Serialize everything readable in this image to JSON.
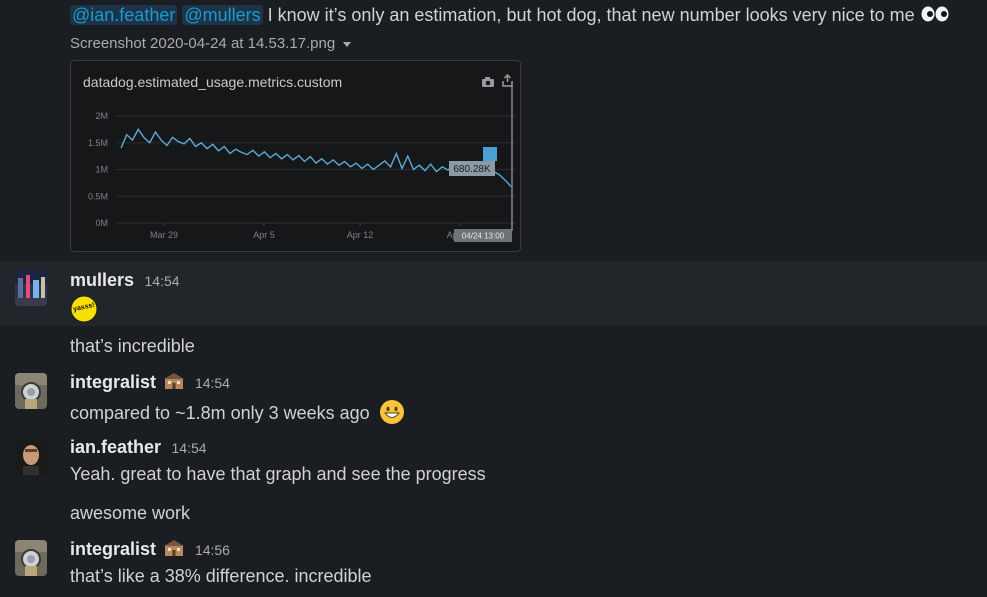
{
  "messages": [
    {
      "mentions": [
        "@ian.feather",
        "@mullers"
      ],
      "text": "I know it’s only an estimation, but hot dog, that new number looks very nice to me",
      "emoji": "eyes-emoji",
      "attachment": {
        "filename": "Screenshot 2020-04-24 at 14.53.17.png",
        "chart_title": "datadog.estimated_usage.metrics.custom",
        "tooltip_value": "680.28K",
        "tooltip_time": "04/24 13:00"
      }
    },
    {
      "user": "mullers",
      "time": "14:54",
      "reaction_label": "yasss!"
    },
    {
      "text": "that’s incredible"
    },
    {
      "user": "integralist",
      "time": "14:54",
      "text": "compared to ~1.8m only 3 weeks ago",
      "emoji": "grinning-face-emoji"
    },
    {
      "user": "ian.feather",
      "time": "14:54",
      "text": "Yeah. great to have that graph and see the progress"
    },
    {
      "text": "awesome work"
    },
    {
      "user": "integralist",
      "time": "14:56",
      "text": "that’s like a 38% difference. incredible"
    }
  ],
  "chart_data": {
    "type": "line",
    "title": "datadog.estimated_usage.metrics.custom",
    "xlabel": "",
    "ylabel": "",
    "x_ticks": [
      "Mar 29",
      "Apr 5",
      "Apr 12",
      "Apr 19"
    ],
    "y_ticks": [
      "0M",
      "0.5M",
      "1M",
      "1.5M",
      "2M"
    ],
    "ylim": [
      0,
      2000000
    ],
    "series": [
      {
        "values": [
          1400000,
          1650000,
          1550000,
          1750000,
          1600000,
          1500000,
          1700000,
          1550000,
          1450000,
          1600000,
          1520000,
          1480000,
          1580000,
          1430000,
          1500000,
          1390000,
          1470000,
          1350000,
          1430000,
          1300000,
          1380000,
          1320000,
          1280000,
          1360000,
          1250000,
          1330000,
          1220000,
          1300000,
          1200000,
          1280000,
          1180000,
          1260000,
          1150000,
          1240000,
          1120000,
          1200000,
          1100000,
          1180000,
          1080000,
          1150000,
          1050000,
          1120000,
          1020000,
          1100000,
          1000000,
          1080000,
          1160000,
          1050000,
          1300000,
          1020000,
          1250000,
          1000000,
          1080000,
          980000,
          1100000,
          960000,
          1050000,
          990000,
          1070000,
          950000,
          1030000,
          970000,
          1000000,
          940000,
          1020000,
          960000,
          900000,
          800000,
          680280
        ]
      }
    ],
    "annotation": {
      "value_label": "680.28K",
      "time_label": "04/24 13:00"
    },
    "grid": true
  },
  "colors": {
    "line": "#5aa9d6",
    "tooltip_bg": "#8a9aa6",
    "marker": "#4a9fd4"
  }
}
